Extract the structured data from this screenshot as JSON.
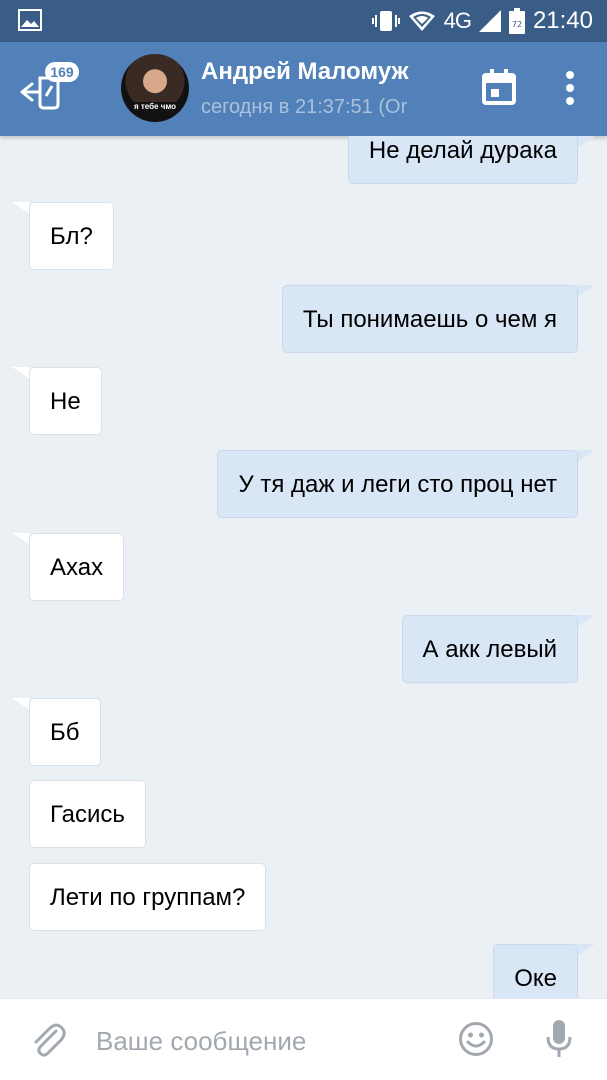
{
  "status_bar": {
    "network": "4G",
    "battery": "72",
    "time": "21:40"
  },
  "toolbar": {
    "badge_count": "169",
    "peer_name": "Андрей Маломуж",
    "peer_status": "сегодня в 21:37:51 (Or",
    "avatar_caption": "я тебе чмо"
  },
  "messages": [
    {
      "dir": "out",
      "text": "Не делай дурака"
    },
    {
      "dir": "in",
      "text": "Бл?"
    },
    {
      "dir": "out",
      "text": "Ты понимаешь о чем я"
    },
    {
      "dir": "in",
      "text": "Не"
    },
    {
      "dir": "out",
      "text": "У тя даж и леги сто проц нет"
    },
    {
      "dir": "in",
      "text": "Ахах"
    },
    {
      "dir": "out",
      "text": "А акк левый"
    },
    {
      "dir": "in",
      "text": "Бб"
    },
    {
      "dir": "in",
      "text": "Гасись"
    },
    {
      "dir": "in",
      "text": "Лети по группам?"
    },
    {
      "dir": "out",
      "text": "Оке"
    }
  ],
  "composer": {
    "placeholder": "Ваше сообщение",
    "value": ""
  },
  "colors": {
    "status_bar": "#3a5d87",
    "toolbar": "#5181b8",
    "background": "#ebf0f5",
    "incoming_bubble": "#ffffff",
    "outgoing_bubble": "#d9e6f6"
  },
  "icons": [
    "image-icon",
    "vibrate-icon",
    "wifi-icon",
    "signal-icon",
    "battery-icon",
    "back-arrow-icon",
    "calendar-icon",
    "more-vert-icon",
    "paperclip-icon",
    "smile-icon",
    "mic-icon"
  ]
}
